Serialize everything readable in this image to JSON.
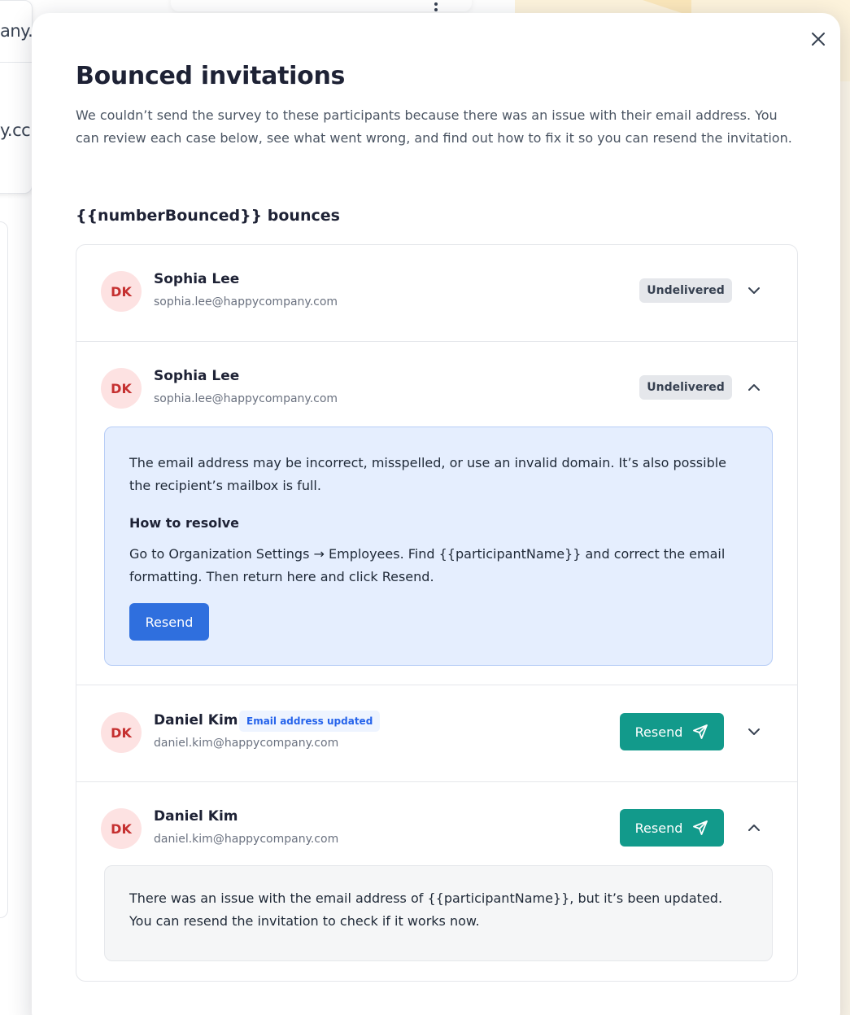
{
  "background": {
    "text_line_1": "any.c",
    "text_line_2": "y.cc"
  },
  "modal": {
    "close_label": "Close",
    "title": "Bounced invitations",
    "description": "We couldn’t send the survey to these participants because there was an issue with their email address. You can review each case below, see what went wrong, and find out how to fix it so you can resend the invitation.",
    "bounces_heading": "{{numberBounced}} bounces"
  },
  "rows": [
    {
      "initials": "DK",
      "name": "Sophia Lee",
      "email": "sophia.lee@happycompany.com",
      "status": "Undelivered"
    },
    {
      "initials": "DK",
      "name": "Sophia Lee",
      "email": "sophia.lee@happycompany.com",
      "status": "Undelivered",
      "details": {
        "reason": "The email address may be incorrect, misspelled, or use an invalid domain. It’s also possible the recipient’s mailbox is full.",
        "resolve_heading": "How to resolve",
        "resolve_text": "Go to Organization Settings → Employees. Find {{participantName}} and correct the email formatting. Then return here and click Resend.",
        "resend_label": "Resend"
      }
    },
    {
      "initials": "DK",
      "name": "Daniel Kim",
      "tag": "Email address updated",
      "email": "daniel.kim@happycompany.com",
      "resend_label": "Resend"
    },
    {
      "initials": "DK",
      "name": "Daniel Kim",
      "email": "daniel.kim@happycompany.com",
      "resend_label": "Resend",
      "details": {
        "message": "There was an issue with the email address of {{participantName}}, but it’s been updated. You can resend the invitation to check if it works now."
      }
    }
  ],
  "colors": {
    "accent_blue": "#2f6fde",
    "accent_teal": "#129a8b",
    "avatar_bg": "#fde2e2",
    "avatar_text": "#c53030"
  }
}
